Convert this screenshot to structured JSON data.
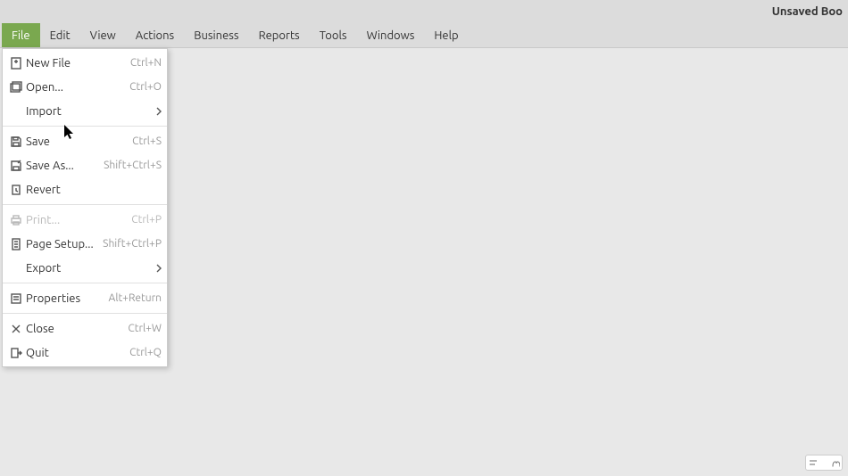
{
  "titlebar": {
    "title": "Unsaved Boo"
  },
  "menubar": {
    "items": [
      {
        "label": "File",
        "active": true
      },
      {
        "label": "Edit"
      },
      {
        "label": "View"
      },
      {
        "label": "Actions"
      },
      {
        "label": "Business"
      },
      {
        "label": "Reports"
      },
      {
        "label": "Tools"
      },
      {
        "label": "Windows"
      },
      {
        "label": "Help"
      }
    ]
  },
  "dropdown": {
    "items": [
      {
        "icon": "new-file-icon",
        "label": "New File",
        "shortcut": "Ctrl+N"
      },
      {
        "icon": "open-icon",
        "label": "Open...",
        "shortcut": "Ctrl+O"
      },
      {
        "icon": "",
        "label": "Import",
        "submenu": true
      },
      {
        "separator": true
      },
      {
        "icon": "save-icon",
        "label": "Save",
        "shortcut": "Ctrl+S"
      },
      {
        "icon": "save-as-icon",
        "label": "Save As...",
        "shortcut": "Shift+Ctrl+S"
      },
      {
        "icon": "revert-icon",
        "label": "Revert"
      },
      {
        "separator": true
      },
      {
        "icon": "print-icon",
        "label": "Print...",
        "shortcut": "Ctrl+P",
        "disabled": true
      },
      {
        "icon": "page-setup-icon",
        "label": "Page Setup...",
        "shortcut": "Shift+Ctrl+P"
      },
      {
        "icon": "",
        "label": "Export",
        "submenu": true
      },
      {
        "separator": true
      },
      {
        "icon": "properties-icon",
        "label": "Properties",
        "shortcut": "Alt+Return"
      },
      {
        "separator": true
      },
      {
        "icon": "close-icon",
        "label": "Close",
        "shortcut": "Ctrl+W"
      },
      {
        "icon": "quit-icon",
        "label": "Quit",
        "shortcut": "Ctrl+Q"
      }
    ]
  }
}
